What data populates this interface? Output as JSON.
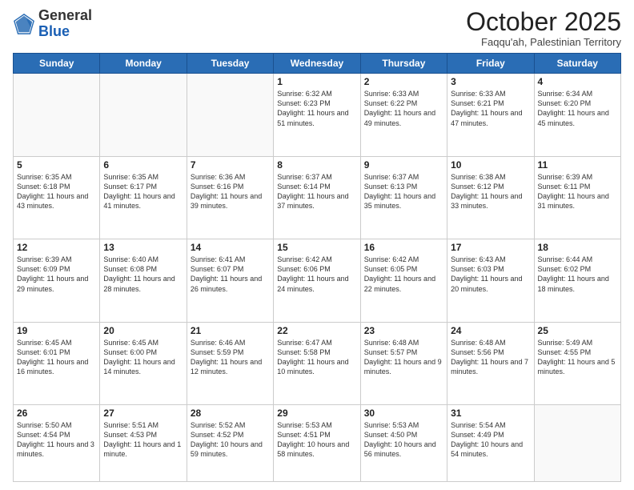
{
  "header": {
    "logo_general": "General",
    "logo_blue": "Blue",
    "title": "October 2025",
    "subtitle": "Faqqu'ah, Palestinian Territory"
  },
  "days_of_week": [
    "Sunday",
    "Monday",
    "Tuesday",
    "Wednesday",
    "Thursday",
    "Friday",
    "Saturday"
  ],
  "weeks": [
    [
      {
        "day": "",
        "info": ""
      },
      {
        "day": "",
        "info": ""
      },
      {
        "day": "",
        "info": ""
      },
      {
        "day": "1",
        "info": "Sunrise: 6:32 AM\nSunset: 6:23 PM\nDaylight: 11 hours and 51 minutes."
      },
      {
        "day": "2",
        "info": "Sunrise: 6:33 AM\nSunset: 6:22 PM\nDaylight: 11 hours and 49 minutes."
      },
      {
        "day": "3",
        "info": "Sunrise: 6:33 AM\nSunset: 6:21 PM\nDaylight: 11 hours and 47 minutes."
      },
      {
        "day": "4",
        "info": "Sunrise: 6:34 AM\nSunset: 6:20 PM\nDaylight: 11 hours and 45 minutes."
      }
    ],
    [
      {
        "day": "5",
        "info": "Sunrise: 6:35 AM\nSunset: 6:18 PM\nDaylight: 11 hours and 43 minutes."
      },
      {
        "day": "6",
        "info": "Sunrise: 6:35 AM\nSunset: 6:17 PM\nDaylight: 11 hours and 41 minutes."
      },
      {
        "day": "7",
        "info": "Sunrise: 6:36 AM\nSunset: 6:16 PM\nDaylight: 11 hours and 39 minutes."
      },
      {
        "day": "8",
        "info": "Sunrise: 6:37 AM\nSunset: 6:14 PM\nDaylight: 11 hours and 37 minutes."
      },
      {
        "day": "9",
        "info": "Sunrise: 6:37 AM\nSunset: 6:13 PM\nDaylight: 11 hours and 35 minutes."
      },
      {
        "day": "10",
        "info": "Sunrise: 6:38 AM\nSunset: 6:12 PM\nDaylight: 11 hours and 33 minutes."
      },
      {
        "day": "11",
        "info": "Sunrise: 6:39 AM\nSunset: 6:11 PM\nDaylight: 11 hours and 31 minutes."
      }
    ],
    [
      {
        "day": "12",
        "info": "Sunrise: 6:39 AM\nSunset: 6:09 PM\nDaylight: 11 hours and 29 minutes."
      },
      {
        "day": "13",
        "info": "Sunrise: 6:40 AM\nSunset: 6:08 PM\nDaylight: 11 hours and 28 minutes."
      },
      {
        "day": "14",
        "info": "Sunrise: 6:41 AM\nSunset: 6:07 PM\nDaylight: 11 hours and 26 minutes."
      },
      {
        "day": "15",
        "info": "Sunrise: 6:42 AM\nSunset: 6:06 PM\nDaylight: 11 hours and 24 minutes."
      },
      {
        "day": "16",
        "info": "Sunrise: 6:42 AM\nSunset: 6:05 PM\nDaylight: 11 hours and 22 minutes."
      },
      {
        "day": "17",
        "info": "Sunrise: 6:43 AM\nSunset: 6:03 PM\nDaylight: 11 hours and 20 minutes."
      },
      {
        "day": "18",
        "info": "Sunrise: 6:44 AM\nSunset: 6:02 PM\nDaylight: 11 hours and 18 minutes."
      }
    ],
    [
      {
        "day": "19",
        "info": "Sunrise: 6:45 AM\nSunset: 6:01 PM\nDaylight: 11 hours and 16 minutes."
      },
      {
        "day": "20",
        "info": "Sunrise: 6:45 AM\nSunset: 6:00 PM\nDaylight: 11 hours and 14 minutes."
      },
      {
        "day": "21",
        "info": "Sunrise: 6:46 AM\nSunset: 5:59 PM\nDaylight: 11 hours and 12 minutes."
      },
      {
        "day": "22",
        "info": "Sunrise: 6:47 AM\nSunset: 5:58 PM\nDaylight: 11 hours and 10 minutes."
      },
      {
        "day": "23",
        "info": "Sunrise: 6:48 AM\nSunset: 5:57 PM\nDaylight: 11 hours and 9 minutes."
      },
      {
        "day": "24",
        "info": "Sunrise: 6:48 AM\nSunset: 5:56 PM\nDaylight: 11 hours and 7 minutes."
      },
      {
        "day": "25",
        "info": "Sunrise: 5:49 AM\nSunset: 4:55 PM\nDaylight: 11 hours and 5 minutes."
      }
    ],
    [
      {
        "day": "26",
        "info": "Sunrise: 5:50 AM\nSunset: 4:54 PM\nDaylight: 11 hours and 3 minutes."
      },
      {
        "day": "27",
        "info": "Sunrise: 5:51 AM\nSunset: 4:53 PM\nDaylight: 11 hours and 1 minute."
      },
      {
        "day": "28",
        "info": "Sunrise: 5:52 AM\nSunset: 4:52 PM\nDaylight: 10 hours and 59 minutes."
      },
      {
        "day": "29",
        "info": "Sunrise: 5:53 AM\nSunset: 4:51 PM\nDaylight: 10 hours and 58 minutes."
      },
      {
        "day": "30",
        "info": "Sunrise: 5:53 AM\nSunset: 4:50 PM\nDaylight: 10 hours and 56 minutes."
      },
      {
        "day": "31",
        "info": "Sunrise: 5:54 AM\nSunset: 4:49 PM\nDaylight: 10 hours and 54 minutes."
      },
      {
        "day": "",
        "info": ""
      }
    ]
  ]
}
